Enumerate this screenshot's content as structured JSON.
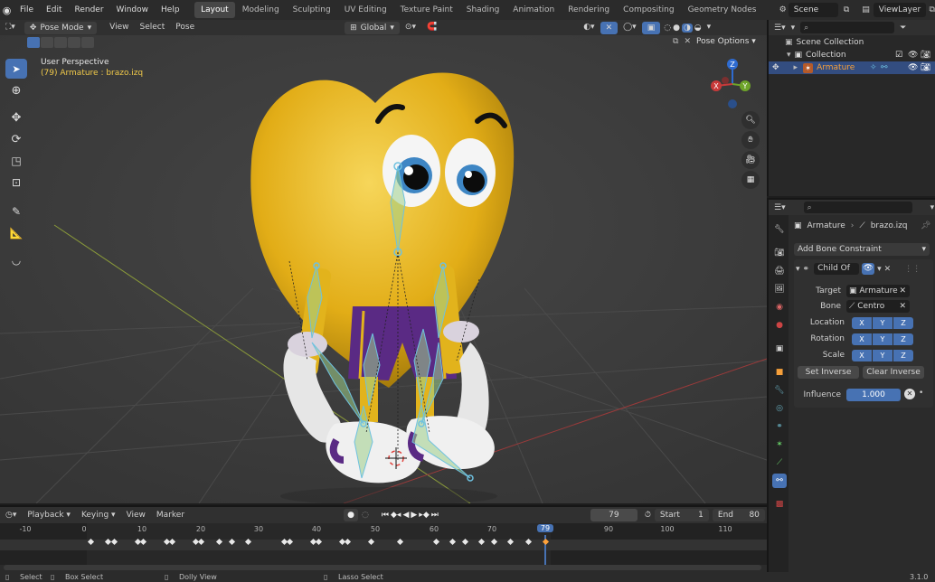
{
  "menu": [
    "File",
    "Edit",
    "Render",
    "Window",
    "Help"
  ],
  "workspaces": [
    "Layout",
    "Modeling",
    "Sculpting",
    "UV Editing",
    "Texture Paint",
    "Shading",
    "Animation",
    "Rendering",
    "Compositing",
    "Geometry Nodes"
  ],
  "active_workspace": "Layout",
  "scene_name": "Scene",
  "view_layer": "ViewLayer",
  "viewport_header": {
    "mode": "Pose Mode",
    "menus": [
      "View",
      "Select",
      "Pose"
    ],
    "orientation": "Global",
    "pose_options": "Pose Options"
  },
  "viewport": {
    "perspective_label": "User Perspective",
    "object_label": "(79) Armature : brazo.izq",
    "gizmo_axes": [
      "X",
      "Y",
      "Z"
    ]
  },
  "outliner": {
    "scene_collection": "Scene Collection",
    "collection": "Collection",
    "armature": "Armature"
  },
  "properties": {
    "breadcrumb_object": "Armature",
    "breadcrumb_bone": "brazo.izq",
    "add_constraint": "Add Bone Constraint",
    "constraint_name": "Child Of",
    "target_label": "Target",
    "target_value": "Armature",
    "bone_label": "Bone",
    "bone_value": "Centro",
    "location_label": "Location",
    "rotation_label": "Rotation",
    "scale_label": "Scale",
    "axes": [
      "X",
      "Y",
      "Z"
    ],
    "set_inverse": "Set Inverse",
    "clear_inverse": "Clear Inverse",
    "influence_label": "Influence",
    "influence_value": "1.000"
  },
  "timeline": {
    "menus": [
      "Playback",
      "Keying",
      "View",
      "Marker"
    ],
    "current_frame": "79",
    "start_label": "Start",
    "start_value": "1",
    "end_label": "End",
    "end_value": "80",
    "ticks": [
      "-10",
      "0",
      "10",
      "20",
      "30",
      "40",
      "50",
      "60",
      "70",
      "79",
      "90",
      "100",
      "110"
    ]
  },
  "statusbar": {
    "select": "Select",
    "box_select": "Box Select",
    "dolly_view": "Dolly View",
    "lasso_select": "Lasso Select",
    "version": "3.1.0"
  },
  "colors": {
    "accent_blue": "#4772b3",
    "active_orange": "#f59f3a",
    "viewport_bg": "#3c3c3c",
    "heart_yellow": "#e8b81f"
  }
}
